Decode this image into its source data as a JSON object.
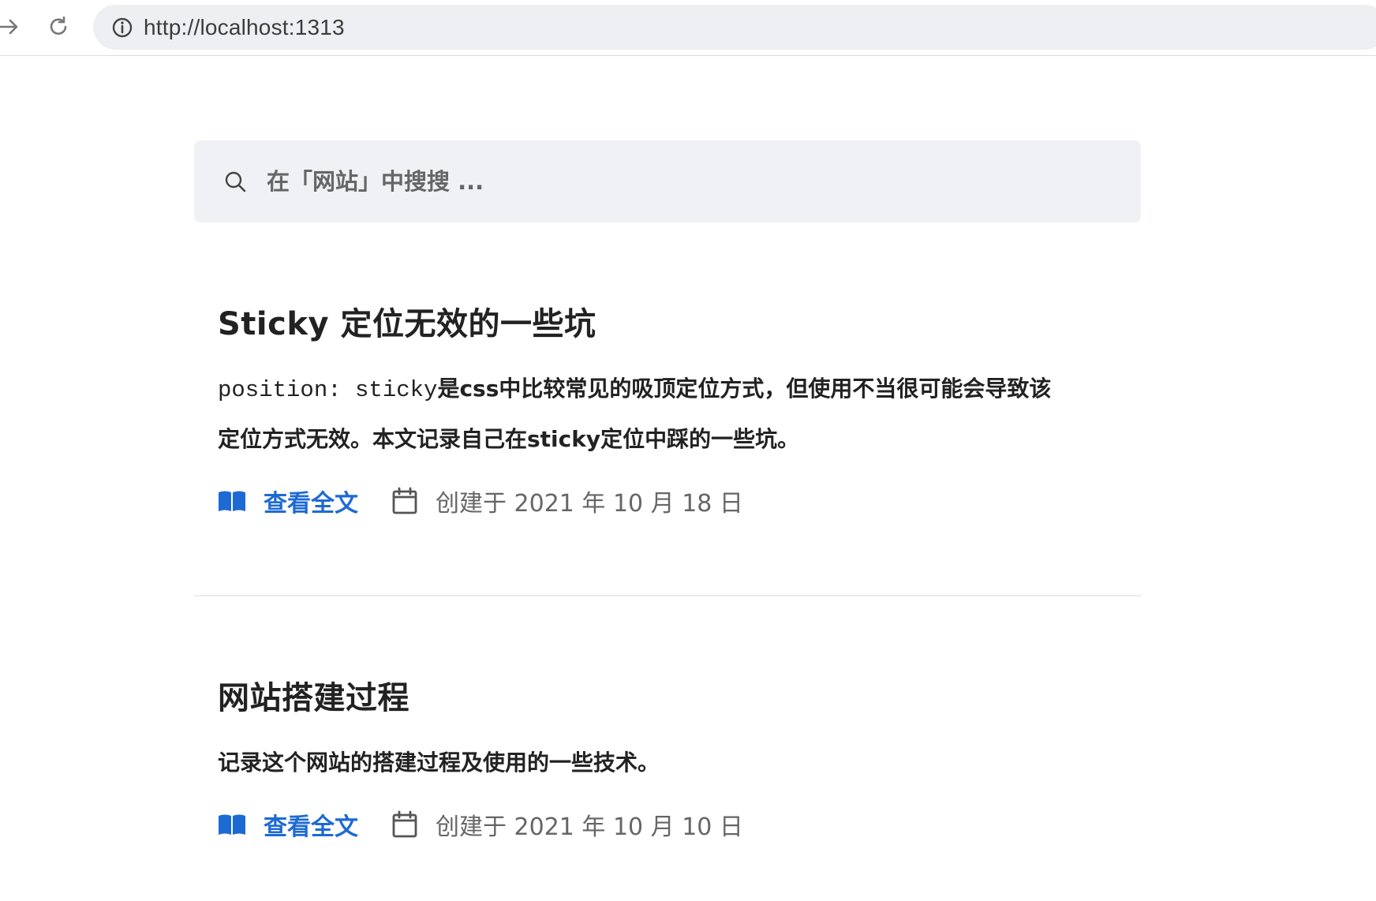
{
  "browser": {
    "url": "http://localhost:1313"
  },
  "search": {
    "placeholder": "在「网站」中搜搜 ..."
  },
  "posts": [
    {
      "title": "Sticky 定位无效的一些坑",
      "summary_code": "position: sticky",
      "summary_text_1": "是css中比较常见的吸顶定位方式，但使用不当很可能会导致该",
      "summary_text_2": "定位方式无效。本文记录自己在sticky定位中踩的一些坑。",
      "read_label": "查看全文",
      "date_label": "创建于 2021 年 10 月 18 日"
    },
    {
      "title": "网站搭建过程",
      "summary_text_1": "记录这个网站的搭建过程及使用的一些技术。",
      "read_label": "查看全文",
      "date_label": "创建于 2021 年 10 月 10 日"
    }
  ],
  "colors": {
    "link": "#1e6ad4",
    "search_bg": "#f0f1f4",
    "address_bg": "#eeeff2"
  },
  "icons": {
    "forward": "arrow-right-icon",
    "reload": "reload-icon",
    "info": "info-icon",
    "search": "search-icon",
    "book": "book-icon",
    "calendar": "calendar-icon"
  }
}
